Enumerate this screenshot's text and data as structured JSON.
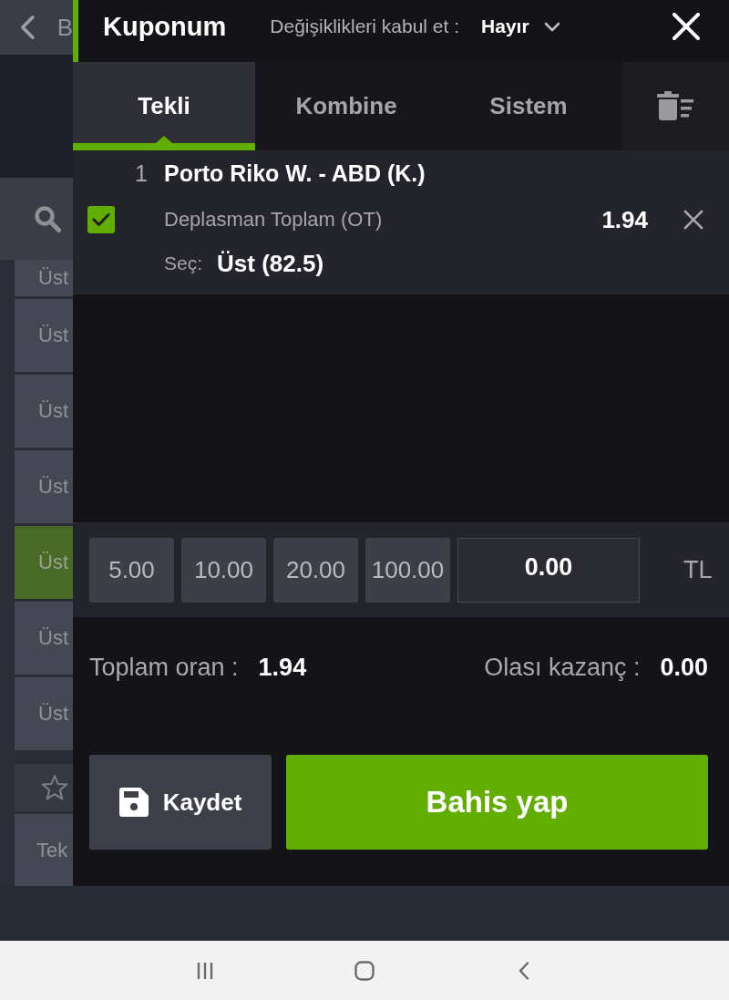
{
  "background_screen": {
    "header_title": "B",
    "list_items": [
      {
        "label": "Üst",
        "selected": false
      },
      {
        "label": "Üst",
        "selected": false
      },
      {
        "label": "Üst",
        "selected": false
      },
      {
        "label": "Üst",
        "selected": false
      },
      {
        "label": "Üst",
        "selected": true
      },
      {
        "label": "Üst",
        "selected": false
      },
      {
        "label": "Üst",
        "selected": false
      }
    ],
    "lower_list_items": [
      {
        "label": "Tek"
      }
    ]
  },
  "coupon": {
    "title": "Kuponum",
    "accept_changes_label": "Değişiklikleri kabul et :",
    "accept_changes_value": "Hayır",
    "tabs": [
      {
        "label": "Tekli",
        "selected": true
      },
      {
        "label": "Kombine",
        "selected": false
      },
      {
        "label": "Sistem",
        "selected": false
      }
    ],
    "bets": [
      {
        "number": "1",
        "match": "Porto Riko W. - ABD (K.)",
        "checked": true,
        "market": "Deplasman Toplam (OT)",
        "odds": "1.94",
        "pick_label": "Seç:",
        "pick": "Üst (82.5)"
      }
    ],
    "quick_stakes": [
      "5.00",
      "10.00",
      "20.00",
      "100.00"
    ],
    "stake_input": {
      "value": "0.00"
    },
    "currency": "TL",
    "total_odds_label": "Toplam oran :",
    "total_odds": "1.94",
    "potential_win_label": "Olası kazanç :",
    "potential_win": "0.00",
    "save_button": "Kaydet",
    "place_bet_button": "Bahis yap"
  }
}
